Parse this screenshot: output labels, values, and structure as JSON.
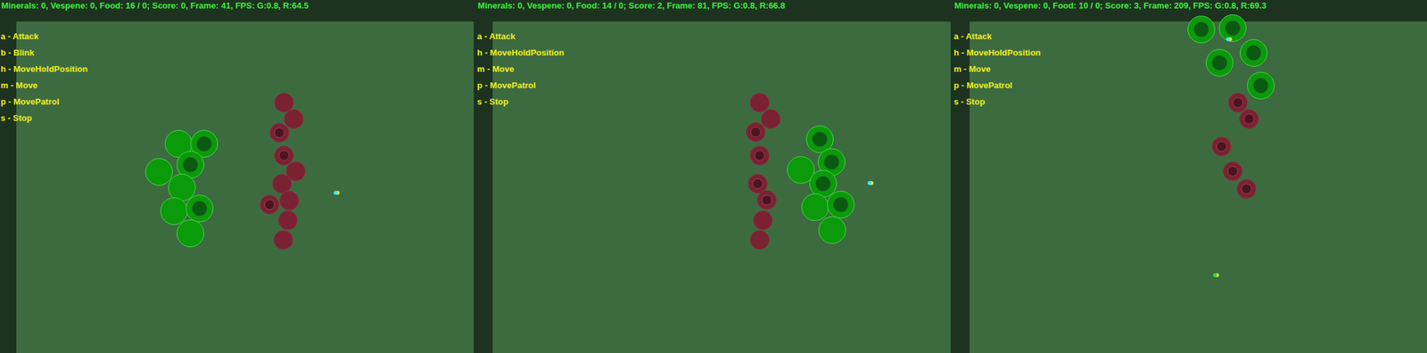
{
  "panels": [
    {
      "status": "Minerals: 0, Vespene: 0, Food: 16 / 0; Score: 0, Frame: 41, FPS: G:0.8, R:64.5",
      "actions": [
        "a - Attack",
        "b - Blink",
        "h - MoveHoldPosition",
        "m - Move",
        "p - MovePatrol",
        "s - Stop"
      ],
      "units": [
        {
          "kind": "ally",
          "marked": false,
          "color": "#0a9a0a"
        },
        {
          "kind": "ally",
          "marked": true,
          "color": "#0a9a0a"
        },
        {
          "kind": "ally",
          "marked": true,
          "color": "#0a9a0a"
        },
        {
          "kind": "ally",
          "marked": false,
          "color": "#0a9a0a"
        },
        {
          "kind": "ally",
          "marked": false,
          "color": "#0a9a0a"
        },
        {
          "kind": "ally",
          "marked": false,
          "color": "#0a9a0a"
        },
        {
          "kind": "ally",
          "marked": true,
          "color": "#0a9a0a"
        },
        {
          "kind": "ally",
          "marked": false,
          "color": "#0a9a0a"
        },
        {
          "kind": "enemy",
          "marked": false,
          "color": "#7a2232"
        },
        {
          "kind": "enemy",
          "marked": false,
          "color": "#7a2232"
        },
        {
          "kind": "enemy",
          "marked": true,
          "color": "#7a2232"
        },
        {
          "kind": "enemy",
          "marked": true,
          "color": "#7a2232"
        },
        {
          "kind": "enemy",
          "marked": false,
          "color": "#7a2232"
        },
        {
          "kind": "enemy",
          "marked": false,
          "color": "#7a2232"
        },
        {
          "kind": "enemy",
          "marked": true,
          "color": "#7a2232"
        },
        {
          "kind": "enemy",
          "marked": false,
          "color": "#7a2232"
        },
        {
          "kind": "enemy",
          "marked": false,
          "color": "#7a2232"
        },
        {
          "kind": "enemy",
          "marked": false,
          "color": "#7a2232"
        }
      ]
    },
    {
      "status": "Minerals: 0, Vespene: 0, Food: 14 / 0; Score: 2, Frame: 81, FPS: G:0.8, R:66.8",
      "actions": [
        "a - Attack",
        "h - MoveHoldPosition",
        "m - Move",
        "p - MovePatrol",
        "s - Stop"
      ],
      "units": [
        {
          "kind": "ally",
          "marked": true,
          "color": "#0a9a0a"
        },
        {
          "kind": "ally",
          "marked": true,
          "color": "#0a9a0a"
        },
        {
          "kind": "ally",
          "marked": false,
          "color": "#0a9a0a"
        },
        {
          "kind": "ally",
          "marked": true,
          "color": "#0a9a0a"
        },
        {
          "kind": "ally",
          "marked": false,
          "color": "#0a9a0a"
        },
        {
          "kind": "ally",
          "marked": true,
          "color": "#0a9a0a"
        },
        {
          "kind": "ally",
          "marked": false,
          "color": "#0a9a0a"
        },
        {
          "kind": "enemy",
          "marked": false,
          "color": "#7a2232"
        },
        {
          "kind": "enemy",
          "marked": false,
          "color": "#7a2232"
        },
        {
          "kind": "enemy",
          "marked": true,
          "color": "#7a2232"
        },
        {
          "kind": "enemy",
          "marked": true,
          "color": "#7a2232"
        },
        {
          "kind": "enemy",
          "marked": true,
          "color": "#7a2232"
        },
        {
          "kind": "enemy",
          "marked": true,
          "color": "#7a2232"
        },
        {
          "kind": "enemy",
          "marked": false,
          "color": "#7a2232"
        },
        {
          "kind": "enemy",
          "marked": false,
          "color": "#7a2232"
        }
      ]
    },
    {
      "status": "Minerals: 0, Vespene: 0, Food: 10 / 0; Score: 3, Frame: 209, FPS: G:0.8, R:69.3",
      "actions": [
        "a - Attack",
        "h - MoveHoldPosition",
        "m - Move",
        "p - MovePatrol",
        "s - Stop"
      ],
      "units": [
        {
          "kind": "ally",
          "marked": true,
          "color": "#0a9a0a"
        },
        {
          "kind": "ally",
          "marked": true,
          "color": "#0a9a0a"
        },
        {
          "kind": "ally",
          "marked": true,
          "color": "#0a9a0a"
        },
        {
          "kind": "ally",
          "marked": true,
          "color": "#0a9a0a"
        },
        {
          "kind": "ally",
          "marked": true,
          "color": "#0a9a0a"
        },
        {
          "kind": "enemy",
          "marked": true,
          "color": "#7a2232"
        },
        {
          "kind": "enemy",
          "marked": true,
          "color": "#7a2232"
        },
        {
          "kind": "enemy",
          "marked": true,
          "color": "#7a2232"
        },
        {
          "kind": "enemy",
          "marked": true,
          "color": "#7a2232"
        },
        {
          "kind": "enemy",
          "marked": true,
          "color": "#7a2232"
        }
      ]
    }
  ]
}
